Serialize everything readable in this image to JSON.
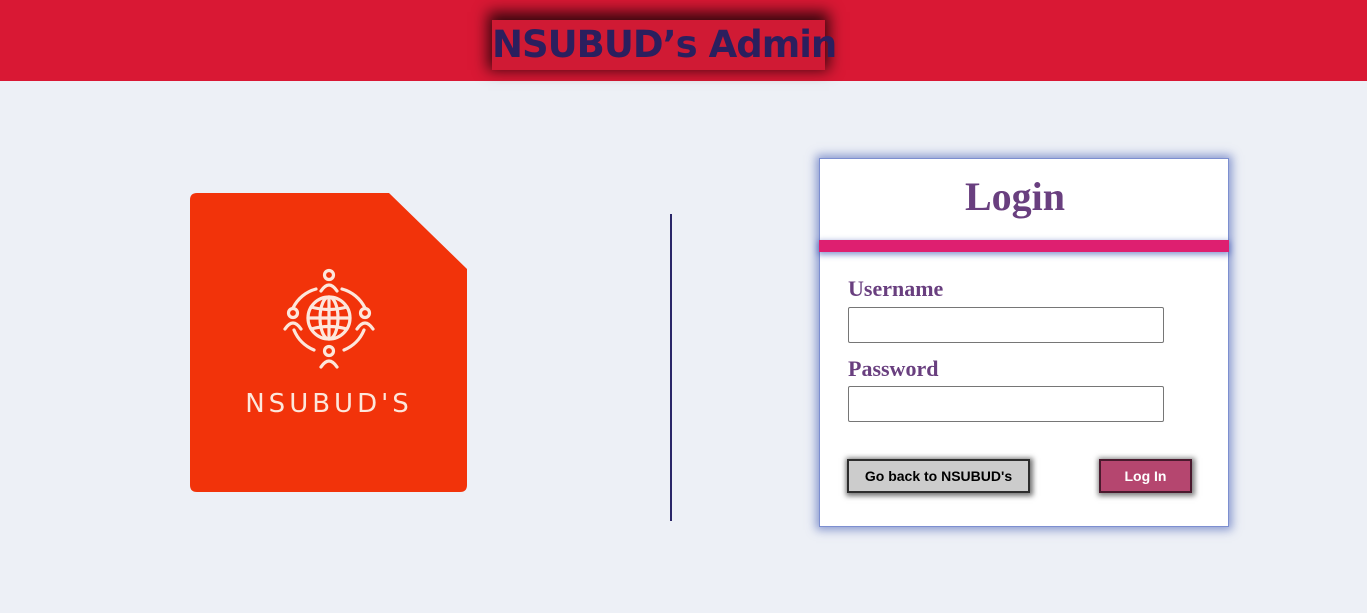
{
  "header": {
    "title": "NSUBUD’s Admin"
  },
  "logo": {
    "text": "NSUBUD'S",
    "icon": "globe-people-icon",
    "color": "#f2330a"
  },
  "login": {
    "title": "Login",
    "username_label": "Username",
    "username_value": "",
    "password_label": "Password",
    "password_value": "",
    "back_button": "Go back to NSUBUD's",
    "login_button": "Log In"
  },
  "colors": {
    "header_bg": "#d91834",
    "title_text": "#2b1f5e",
    "accent_purple": "#693f7f",
    "stripe_pink": "#de1f70",
    "login_button": "#b5466f",
    "page_bg": "#edf0f6"
  }
}
